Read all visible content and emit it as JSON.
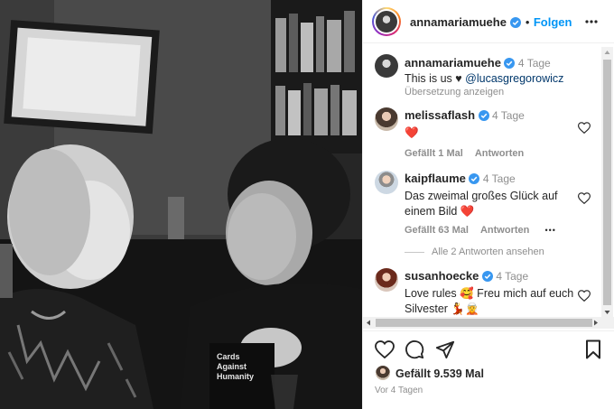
{
  "post": {
    "author": "annamariamuehe",
    "follow_label": "Folgen",
    "separator": "•",
    "caption": {
      "username": "annamariamuehe",
      "time": "4 Tage",
      "text": "This is us ♥",
      "mention": "@lucasgregorowicz",
      "translate_label": "Übersetzung anzeigen"
    },
    "book_text": [
      "Cards",
      "Against",
      "Humanity"
    ]
  },
  "comments": [
    {
      "username": "melissaflash",
      "time": "4 Tage",
      "text": "❤️",
      "likes": "Gefällt 1 Mal",
      "reply_label": "Antworten"
    },
    {
      "username": "kaipflaume",
      "time": "4 Tage",
      "text": "Das zweimal großes Glück auf einem Bild ❤️",
      "likes": "Gefällt 63 Mal",
      "reply_label": "Antworten",
      "more": "•••",
      "view_replies": "Alle 2 Antworten ansehen"
    },
    {
      "username": "susanhoecke",
      "time": "4 Tage",
      "text": "Love rules 🥰 Freu mich auf euch Silvester 💃🧝"
    }
  ],
  "footer": {
    "likes": "Gefällt 9.539 Mal",
    "date": "Vor 4 Tagen"
  },
  "colors": {
    "accent": "#0095f6",
    "verified": "#3897f0",
    "heart": "#ed4956"
  }
}
